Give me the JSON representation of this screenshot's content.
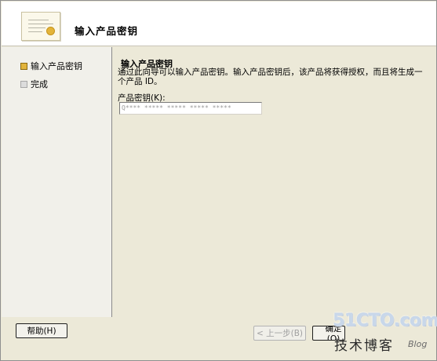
{
  "header": {
    "title": "输入产品密钥"
  },
  "nav": {
    "items": [
      {
        "label": "输入产品密钥",
        "state": "current"
      },
      {
        "label": "完成",
        "state": "pending"
      }
    ]
  },
  "content": {
    "title": "输入产品密钥",
    "description": "通过此向导可以输入产品密钥。输入产品密钥后，该产品将获得授权，而且将生成一个产品 ID。",
    "key_label": "产品密钥(K):",
    "key_value": "Q**** ***** ***** ***** *****"
  },
  "footer": {
    "help_label": "帮助(H)",
    "back_label": "< 上一步(B)",
    "next_label": "确定(O)"
  },
  "watermark": {
    "main": "51CTO.com",
    "sub": "技术博客",
    "blog": "Blog"
  },
  "colors": {
    "window_bg": "#ece9d8",
    "header_bg": "#ffffff",
    "nav_bg": "#f1f0ea",
    "current_marker": "#e2b43c"
  }
}
